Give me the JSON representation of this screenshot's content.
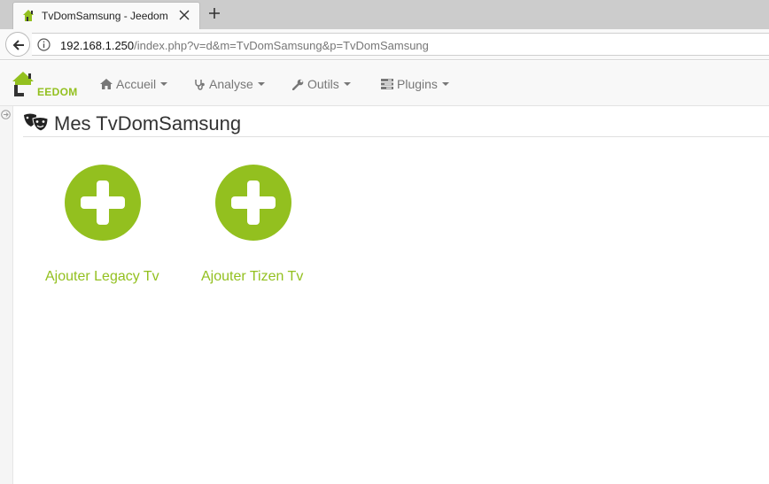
{
  "browser": {
    "tab_title": "TvDomSamsung - Jeedom",
    "url_host": "192.168.1.250",
    "url_path": "/index.php?v=d&m=TvDomSamsung&p=TvDomSamsung"
  },
  "header": {
    "logo_text": "EEDOM",
    "menu": [
      {
        "label": "Accueil",
        "icon": "home-icon"
      },
      {
        "label": "Analyse",
        "icon": "stethoscope-icon"
      },
      {
        "label": "Outils",
        "icon": "wrench-icon"
      },
      {
        "label": "Plugins",
        "icon": "tasks-icon"
      }
    ]
  },
  "main": {
    "title": "Mes TvDomSamsung",
    "cards": [
      {
        "label": "Ajouter Legacy Tv",
        "icon": "plus-circle-icon"
      },
      {
        "label": "Ajouter Tizen Tv",
        "icon": "plus-circle-icon"
      }
    ]
  },
  "colors": {
    "accent": "#93c01f",
    "menu_text": "#777777",
    "title_text": "#333333"
  }
}
